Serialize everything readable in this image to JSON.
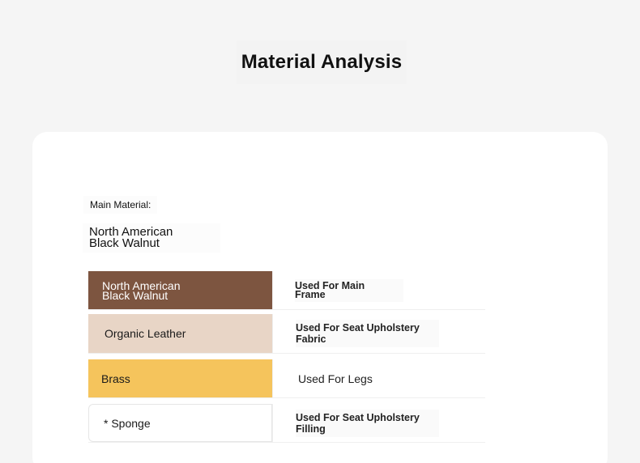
{
  "page": {
    "title": "Material Analysis"
  },
  "main_material": {
    "label": "Main Material:",
    "value_line1": "North American",
    "value_line2": "Black Walnut"
  },
  "materials": [
    {
      "name_line1": "North American",
      "name_line2": "Black Walnut",
      "use_line1": "Used For Main",
      "use_line2": "Frame",
      "swatch_color": "#7d5540",
      "text_color": "#ffffff"
    },
    {
      "name_line1": "Organic Leather",
      "name_line2": "",
      "use_line1": "Used For Seat Upholstery",
      "use_line2": "Fabric",
      "swatch_color": "#e8d5c6",
      "text_color": "#1a1a1a"
    },
    {
      "name_line1": "Brass",
      "name_line2": "",
      "use_line1": "Used For Legs",
      "use_line2": "",
      "swatch_color": "#f5c45c",
      "text_color": "#1a1a1a"
    },
    {
      "name_line1": "* Sponge",
      "name_line2": "",
      "use_line1": "Used For Seat Upholstery",
      "use_line2": "Filling",
      "swatch_color": "#ffffff",
      "text_color": "#1a1a1a"
    }
  ]
}
